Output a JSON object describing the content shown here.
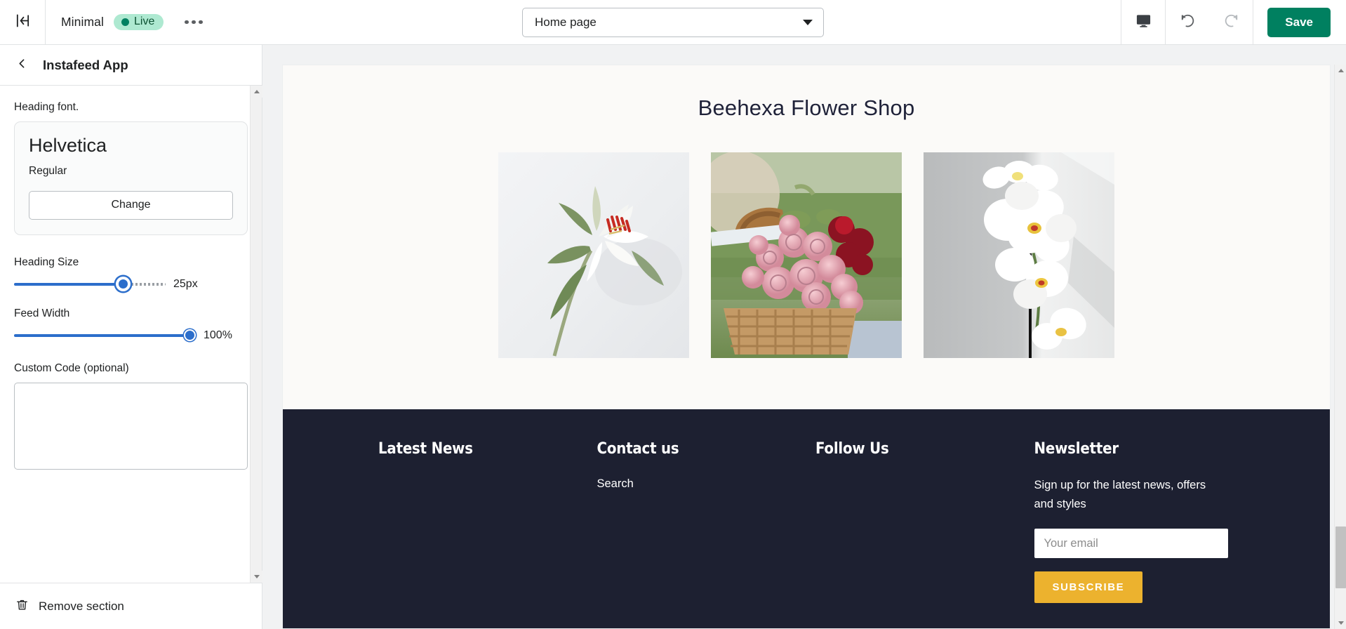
{
  "topbar": {
    "exit_icon": "exit-arrow-icon",
    "theme_name": "Minimal",
    "status_badge": "Live",
    "more_icon": "ellipsis-icon",
    "page_selector": {
      "value": "Home page",
      "caret_icon": "chevron-down-icon"
    },
    "device_icon": "desktop-icon",
    "undo_icon": "undo-icon",
    "redo_icon": "redo-icon",
    "save_label": "Save",
    "save_color": "#008060",
    "badge_bg": "#aee9d1",
    "badge_dot_color": "#008060"
  },
  "sidebar": {
    "back_icon": "chevron-left-icon",
    "title": "Instafeed App",
    "heading_font": {
      "label": "Heading font.",
      "font_name": "Helvetica",
      "font_style": "Regular",
      "change_label": "Change"
    },
    "heading_size": {
      "label": "Heading Size",
      "value": "25px",
      "percent": 70
    },
    "feed_width": {
      "label": "Feed Width",
      "value": "100%",
      "percent": 100
    },
    "custom_code": {
      "label": "Custom Code (optional)",
      "value": "",
      "placeholder": ""
    },
    "remove_section": {
      "icon": "trash-icon",
      "label": "Remove section"
    },
    "slider_color": "#2c6ecb"
  },
  "preview": {
    "site_title": "Beehexa Flower Shop",
    "background": "#fbfaf8",
    "title_color": "#1f2239",
    "feed": [
      {
        "alt": "white-lily-flower"
      },
      {
        "alt": "pink-roses-in-basket"
      },
      {
        "alt": "white-orchid-flowers"
      }
    ],
    "footer": {
      "background": "#1d2031",
      "columns": [
        {
          "title": "Latest News",
          "links": []
        },
        {
          "title": "Contact us",
          "links": [
            "Search"
          ]
        },
        {
          "title": "Follow Us",
          "links": []
        }
      ],
      "newsletter": {
        "title": "Newsletter",
        "description": "Sign up for the latest news, offers and styles",
        "email_value": "",
        "email_placeholder": "Your email",
        "subscribe_label": "SUBSCRIBE",
        "subscribe_color": "#ecb22e"
      }
    }
  }
}
